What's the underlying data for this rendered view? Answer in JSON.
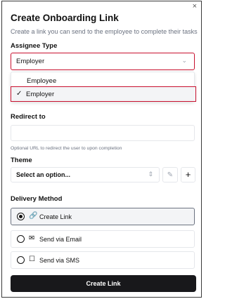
{
  "dialog": {
    "title": "Create Onboarding Link",
    "subtitle": "Create a link you can send to the employee to complete their tasks",
    "close_glyph": "×"
  },
  "assignee": {
    "label": "Assignee Type",
    "selected": "Employer",
    "chevron_icon": "chevron-down-icon",
    "options": [
      {
        "label": "Employee",
        "selected": false
      },
      {
        "label": "Employer",
        "selected": true
      }
    ]
  },
  "redirect": {
    "label": "Redirect to",
    "value": "",
    "hint": "Optional URL to redirect the user to upon completion"
  },
  "theme": {
    "label": "Theme",
    "placeholder": "Select an option...",
    "icons": [
      "updown-icon",
      "pencil-icon",
      "plus-icon"
    ]
  },
  "delivery": {
    "label": "Delivery Method",
    "options": [
      {
        "label": "Create Link",
        "icon": "link-icon",
        "selected": true
      },
      {
        "label": "Send via Email",
        "icon": "mail-icon",
        "selected": false
      },
      {
        "label": "Send via SMS",
        "icon": "message-icon",
        "selected": false
      }
    ]
  },
  "submit": {
    "label": "Create Link"
  },
  "colors": {
    "highlight": "#c8102e",
    "primary": "#18181b",
    "muted": "#6b7280"
  }
}
